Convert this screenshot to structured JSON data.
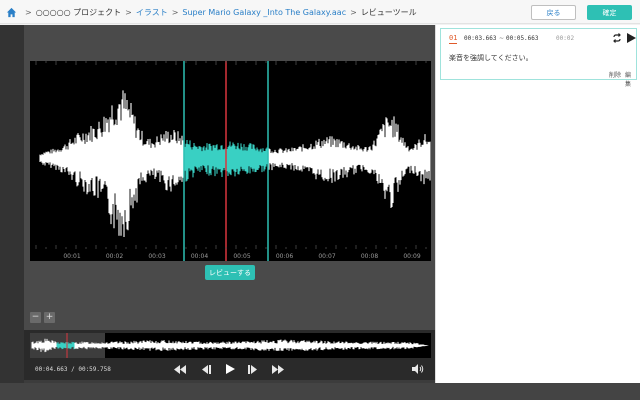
{
  "breadcrumb": {
    "items": [
      {
        "label": "○○○○○ プロジェクト",
        "link": false
      },
      {
        "label": "イラスト",
        "link": true
      },
      {
        "label": "Super Mario Galaxy _Into The Galaxy.aac",
        "link": true
      },
      {
        "label": "レビューツール",
        "link": false
      }
    ],
    "separator": ">"
  },
  "header": {
    "back_label": "戻る",
    "confirm_label": "確定"
  },
  "waveform": {
    "time_labels": [
      "00:01",
      "00:02",
      "00:03",
      "00:04",
      "00:05",
      "00:06",
      "00:07",
      "00:08",
      "00:09"
    ],
    "selection": {
      "start": "00:03.663",
      "end": "00:05.663"
    },
    "playhead": "00:04.663",
    "review_button_label": "レビューする"
  },
  "zoom": {
    "minus": "−",
    "plus": "+"
  },
  "player": {
    "time_readout": "00:04.663 / 00:59.758",
    "controls": [
      "rewind-icon",
      "previous-icon",
      "play-icon",
      "next-icon",
      "fast-forward-icon",
      "volume-icon"
    ]
  },
  "comment": {
    "index": "01",
    "start": "00:03.663",
    "tilde": "~",
    "end": "00:05.663",
    "duration": "00:02",
    "text": "楽音を強調してください。",
    "delete_label": "削除",
    "edit_label": "編集",
    "icons": [
      "repeat-icon",
      "play-icon"
    ]
  },
  "colors": {
    "accent": "#2ec0b4",
    "playhead": "#d9363e",
    "link": "#2a7fc7",
    "selection_wave": "#39d0c3"
  }
}
